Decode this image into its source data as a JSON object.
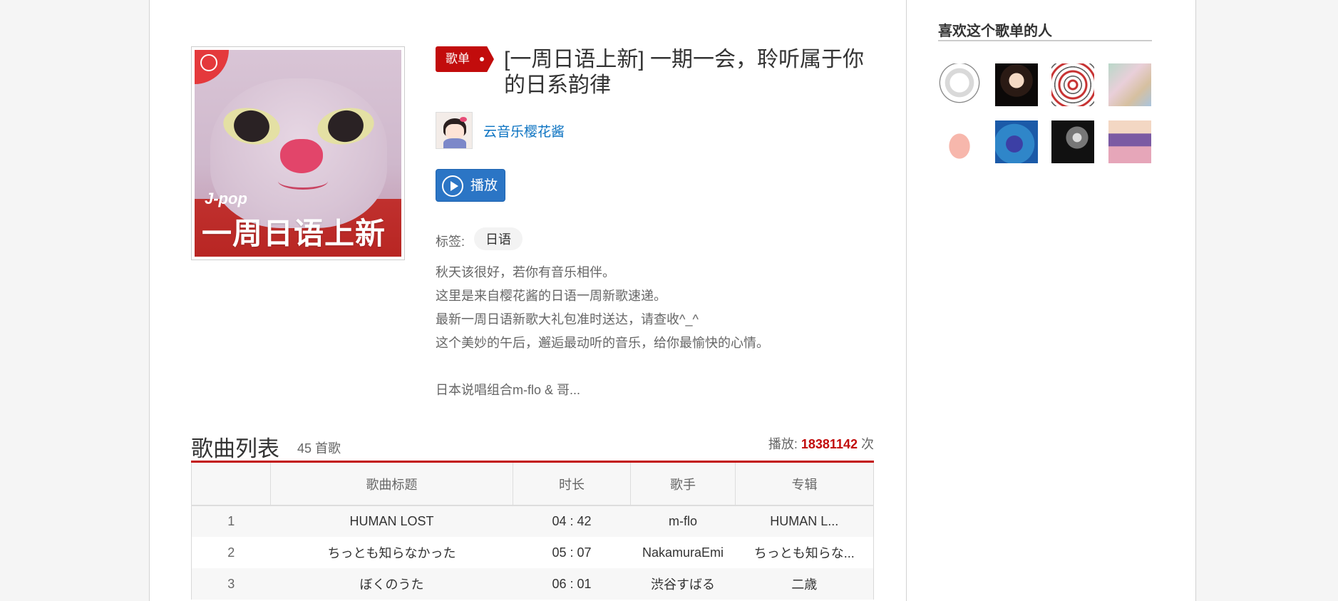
{
  "playlist": {
    "type_label": "歌单",
    "title": "[一周日语上新] 一期一会，聆听属于你的日系韵律",
    "cover": {
      "subtitle": "J-pop",
      "title": "一周日语上新"
    },
    "creator": "云音乐樱花酱",
    "play_label": "播放",
    "tags_label": "标签:",
    "tags": [
      "日语"
    ],
    "description": [
      "秋天该很好，若你有音乐相伴。",
      "这里是来自樱花酱的日语一周新歌速递。",
      "最新一周日语新歌大礼包准时送达，请查收^_^",
      "这个美妙的午后，邂逅最动听的音乐，给你最愉快的心情。",
      "",
      "日本说唱组合m-flo & 哥..."
    ]
  },
  "song_list": {
    "title": "歌曲列表",
    "count": "45 首歌",
    "plays_label": "播放:",
    "plays_value": "18381142",
    "plays_unit": "次",
    "columns": [
      "",
      "歌曲标题",
      "时长",
      "歌手",
      "专辑"
    ],
    "rows": [
      {
        "idx": "1",
        "title": "HUMAN LOST",
        "duration": "04 : 42",
        "artist": "m-flo",
        "album": "HUMAN L..."
      },
      {
        "idx": "2",
        "title": "ちっとも知らなかった",
        "duration": "05 : 07",
        "artist": "NakamuraEmi",
        "album": "ちっとも知らな..."
      },
      {
        "idx": "3",
        "title": "ぼくのうた",
        "duration": "06 : 01",
        "artist": "渋谷すばる",
        "album": "二歳"
      }
    ]
  },
  "likers": {
    "title": "喜欢这个歌单的人",
    "count": 8
  },
  "colors": {
    "accent_red": "#c20c0c",
    "link_blue": "#0c73c2",
    "button_blue": "#2b75c5"
  }
}
